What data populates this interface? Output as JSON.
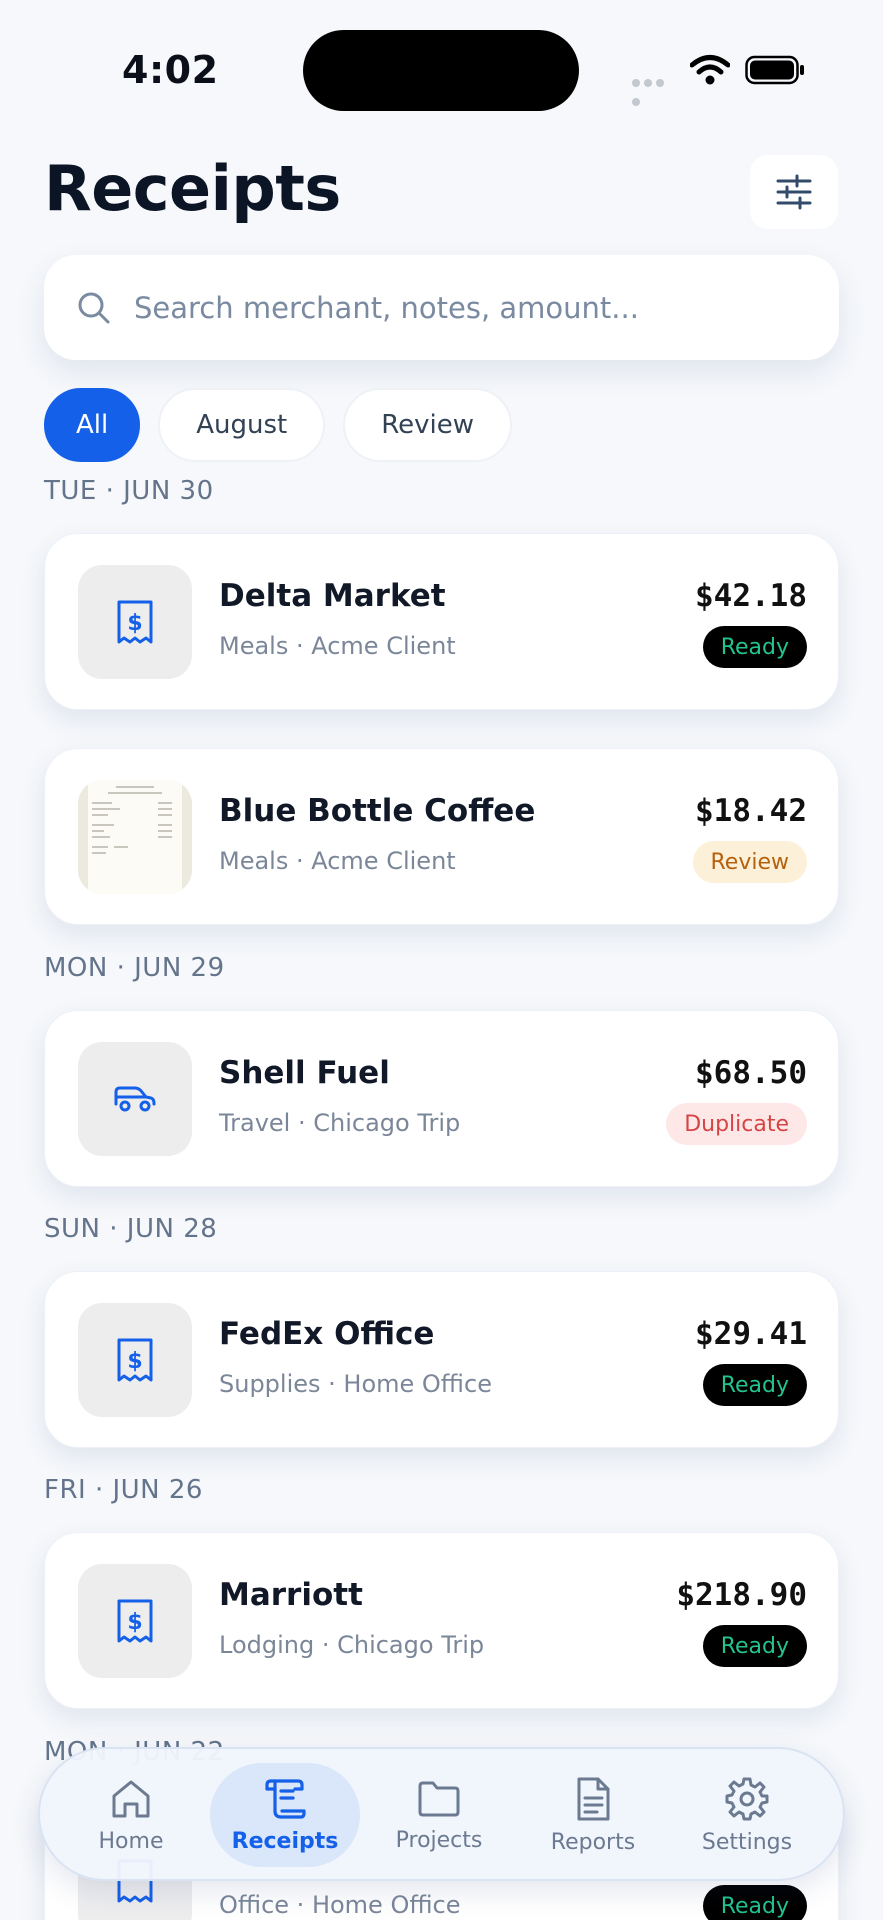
{
  "status": {
    "time": "4:02"
  },
  "header": {
    "title": "Receipts"
  },
  "search": {
    "placeholder": "Search merchant, notes, amount..."
  },
  "chips": [
    {
      "label": "All",
      "active": true
    },
    {
      "label": "August",
      "active": false
    },
    {
      "label": "Review",
      "active": false
    }
  ],
  "groups": [
    {
      "date": "TUE · JUN 30"
    },
    {
      "date": "MON · JUN 29"
    },
    {
      "date": "SUN · JUN 28"
    },
    {
      "date": "FRI · JUN 26"
    },
    {
      "date": "MON · JUN 22"
    }
  ],
  "receipts": [
    {
      "merchant": "Delta Market",
      "meta": "Meals · Acme Client",
      "amount": "$42.18",
      "status": "Ready",
      "icon": "receipt-icon"
    },
    {
      "merchant": "Blue Bottle Coffee",
      "meta": "Meals · Acme Client",
      "amount": "$18.42",
      "status": "Review",
      "icon": "receipt-photo"
    },
    {
      "merchant": "Shell Fuel",
      "meta": "Travel · Chicago Trip",
      "amount": "$68.50",
      "status": "Duplicate",
      "icon": "car-icon"
    },
    {
      "merchant": "FedEx Office",
      "meta": "Supplies · Home Office",
      "amount": "$29.41",
      "status": "Ready",
      "icon": "receipt-icon"
    },
    {
      "merchant": "Marriott",
      "meta": "Lodging · Chicago Trip",
      "amount": "$218.90",
      "status": "Ready",
      "icon": "receipt-icon"
    },
    {
      "merchant": "",
      "meta": "Office · Home Office",
      "amount": "",
      "status": "Ready",
      "icon": "receipt-icon"
    }
  ],
  "nav": [
    {
      "label": "Home",
      "icon": "home-icon"
    },
    {
      "label": "Receipts",
      "icon": "receipts-icon",
      "active": true
    },
    {
      "label": "Projects",
      "icon": "folder-icon"
    },
    {
      "label": "Reports",
      "icon": "document-icon"
    },
    {
      "label": "Settings",
      "icon": "gear-icon"
    }
  ],
  "colors": {
    "accent": "#1560e8",
    "ready_text": "#22c38e",
    "review_bg": "#fdf0d9",
    "duplicate_bg": "#fde7e7"
  }
}
